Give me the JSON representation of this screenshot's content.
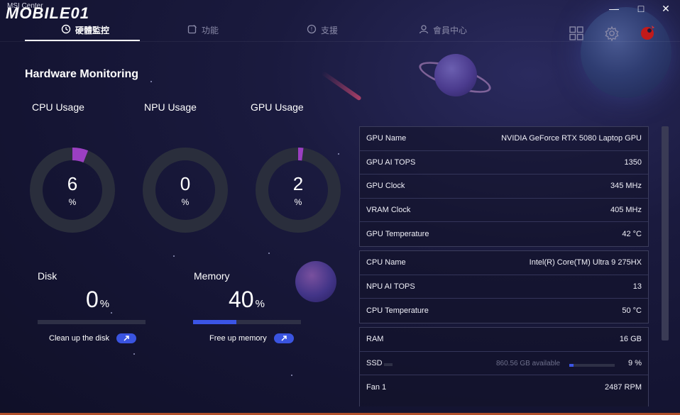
{
  "window": {
    "app_title": "MSI Center",
    "brand": "MOBILE01",
    "controls": {
      "minimize": "—",
      "maximize": "□",
      "close": "✕"
    }
  },
  "nav": {
    "tabs": [
      {
        "label": "硬體監控",
        "icon": "clock-icon",
        "active": true
      },
      {
        "label": "功能",
        "icon": "edit-icon",
        "active": false
      },
      {
        "label": "支援",
        "icon": "help-icon",
        "active": false
      },
      {
        "label": "會員中心",
        "icon": "user-icon",
        "active": false
      }
    ],
    "right_icons": [
      "grid-icon",
      "gear-icon",
      "dragon-logo-icon"
    ]
  },
  "page": {
    "title": "Hardware Monitoring"
  },
  "gauges": [
    {
      "label": "CPU Usage",
      "value": "6",
      "unit": "%",
      "fraction": 0.06
    },
    {
      "label": "NPU Usage",
      "value": "0",
      "unit": "%",
      "fraction": 0.0
    },
    {
      "label": "GPU Usage",
      "value": "2",
      "unit": "%",
      "fraction": 0.02
    }
  ],
  "meters": [
    {
      "label": "Disk",
      "value": "0",
      "unit": "%",
      "fraction": 0.0,
      "action": "Clean up the disk"
    },
    {
      "label": "Memory",
      "value": "40",
      "unit": "%",
      "fraction": 0.4,
      "action": "Free up memory"
    }
  ],
  "gpu_panel": [
    {
      "label": "GPU Name",
      "value": "NVIDIA GeForce RTX 5080 Laptop GPU"
    },
    {
      "label": "GPU AI TOPS",
      "value": "1350"
    },
    {
      "label": "GPU Clock",
      "value": "345 MHz"
    },
    {
      "label": "VRAM Clock",
      "value": "405 MHz"
    },
    {
      "label": "GPU Temperature",
      "value": "42 °C"
    }
  ],
  "cpu_panel": [
    {
      "label": "CPU Name",
      "value": "Intel(R) Core(TM) Ultra 9 275HX"
    },
    {
      "label": "NPU AI TOPS",
      "value": "13"
    },
    {
      "label": "CPU Temperature",
      "value": "50 °C"
    }
  ],
  "system_panel": {
    "ram": {
      "label": "RAM",
      "value": "16 GB"
    },
    "ssd": {
      "label": "SSD",
      "available": "860.56 GB available",
      "value": "9 %",
      "fraction": 0.09
    },
    "fan": {
      "label": "Fan 1",
      "value": "2487 RPM"
    }
  },
  "colors": {
    "accent": "#3b55e6",
    "gauge_fill": "#9b3fc2",
    "gauge_track": "#2a2e3c"
  }
}
